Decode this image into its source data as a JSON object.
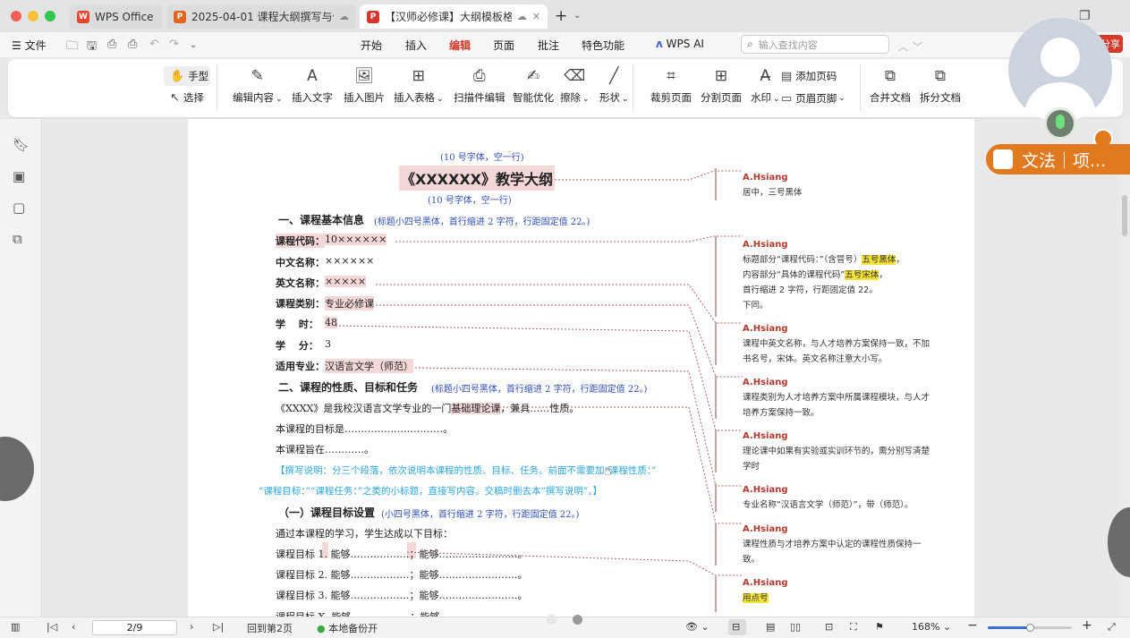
{
  "titlebar": {
    "tabs": [
      {
        "label": "WPS Office",
        "icon": "wps-logo-icon",
        "color": "#e8442e"
      },
      {
        "label": "2025-04-01 课程大纲撰写与优",
        "icon": "slides-icon",
        "color": "#e3651d"
      },
      {
        "label": "【汉师必修课】大纲模板格",
        "icon": "pdf-icon",
        "color": "#d9342b"
      }
    ],
    "new_tab": "+"
  },
  "menubar": {
    "file": "文件",
    "items": [
      "开始",
      "插入",
      "编辑",
      "页面",
      "批注",
      "特色功能"
    ],
    "active": "编辑",
    "wps_ai": "WPS AI",
    "search_placeholder": "输入查找内容",
    "share": "分享"
  },
  "ribbon": {
    "hand": "手型",
    "select": "选择",
    "tools": [
      {
        "label": "编辑内容",
        "icon": "edit-content-icon",
        "glyph": "✎",
        "arrow": true
      },
      {
        "label": "插入文字",
        "icon": "insert-text-icon",
        "glyph": "A",
        "arrow": false
      },
      {
        "label": "插入图片",
        "icon": "insert-image-icon",
        "glyph": "🖼",
        "arrow": false
      },
      {
        "label": "插入表格",
        "icon": "insert-table-icon",
        "glyph": "⊞",
        "arrow": true
      },
      {
        "label": "扫描件编辑",
        "icon": "scan-edit-icon",
        "glyph": "⎙",
        "arrow": false
      },
      {
        "label": "智能优化",
        "icon": "smart-optimize-icon",
        "glyph": "✍",
        "arrow": false
      },
      {
        "label": "擦除",
        "icon": "eraser-icon",
        "glyph": "⌫",
        "arrow": true
      },
      {
        "label": "形状",
        "icon": "shape-icon",
        "glyph": "╱",
        "arrow": true
      },
      {
        "label": "裁剪页面",
        "icon": "crop-page-icon",
        "glyph": "⌗",
        "arrow": false
      },
      {
        "label": "分割页面",
        "icon": "split-page-icon",
        "glyph": "⊞",
        "arrow": false
      },
      {
        "label": "水印",
        "icon": "watermark-icon",
        "glyph": "A̶",
        "arrow": true
      }
    ],
    "add_page_number": "添加页码",
    "header_footer": "页眉页脚",
    "merge_doc": "合并文档",
    "split_doc": "拆分文档"
  },
  "document": {
    "lines": {
      "hint1": "(10 号字体，空一行)",
      "title": "《XXXXXX》教学大纲",
      "hint2": "(10 号字体，空一行)",
      "sec1": "一、课程基本信息",
      "sec1_hint": "(标题小四号黑体，首行缩进 2 字符，行距固定值 22。)",
      "code_label": "课程代码：",
      "code_value": "10××××××",
      "cn_label": "中文名称：",
      "cn_value": "××××××",
      "en_label": "英文名称：",
      "en_value": "×××××",
      "type_label": "课程类别：",
      "type_value": "专业必修课",
      "hours_label": "学　 时：",
      "hours_value": "48",
      "credit_label": "学　 分：",
      "credit_value": "3",
      "major_label": "适用专业：",
      "major_value": "汉语言文学（师范）",
      "sec2": "二、课程的性质、目标和任务",
      "sec2_hint": "(标题小四号黑体，首行缩进 2 字符，行距固定值 22。)",
      "p1a": "《XXXX》是我校汉语言文学专业的一门",
      "p1b": "基础理论课",
      "p1c": "，兼具……性质。",
      "p2": "本课程的目标是…………………………。",
      "p3": "本课程旨在…………。",
      "note1": "【撰写说明：分三个段落，依次说明本课程的性质、目标、任务。前面不需要加“课程性质：”",
      "note2": "“课程目标：”“课程任务：”之类的小标题，直接写内容。交稿时删去本“撰写说明”。】",
      "sub1": "（一）课程目标设置",
      "sub1_hint": "(小四号黑体，首行缩进 2 字符，行距固定值 22。)",
      "p4": "通过本课程的学习，学生达成以下目标：",
      "goal1": "课程目标 1. 能够………………；能够……………………。",
      "goal2": "课程目标 2. 能够………………；能够……………………。",
      "goal3": "课程目标 3. 能够………………；能够……………………。",
      "goalx": "课程目标 X. 能够………………；能够……………………。"
    },
    "comments": [
      {
        "author": "A.Hsiang",
        "text": "居中，三号黑体"
      },
      {
        "author": "A.Hsiang",
        "text1": "标题部分“课程代码：”（含冒号）",
        "hl1": "五号黑体",
        "text2": "，",
        "text3": "内容部分“具体的课程代码”",
        "hl2": "五号宋体",
        "text4": "，",
        "text5": "首行缩进 2 字符，行距固定值 22。",
        "text6": "下同。"
      },
      {
        "author": "A.Hsiang",
        "text1": "课程中英文名称，与人才培养方案保持一致，不加",
        "text2": "书名号，宋体。英文名称注意大小写。"
      },
      {
        "author": "A.Hsiang",
        "text1": "课程类别为人才培养方案中所属课程模块，与人才",
        "text2": "培养方案保持一致。"
      },
      {
        "author": "A.Hsiang",
        "text1": "理论课中如果有实验或实训环节的，需分别写清楚",
        "text2": "学时"
      },
      {
        "author": "A.Hsiang",
        "text": "专业名称“汉语言文学（师范）”，带（师范）。"
      },
      {
        "author": "A.Hsiang",
        "text1": "课程性质与才培养方案中认定的课程性质保持一",
        "text2": "致。"
      },
      {
        "author": "A.Hsiang",
        "hl": "用点号"
      }
    ]
  },
  "statusbar": {
    "page_value": "2/9",
    "back_to_page": "回到第2页",
    "local_backup": "本地备份开",
    "zoom": "168%"
  },
  "overlay": {
    "chat_label": "文法｜项..."
  }
}
